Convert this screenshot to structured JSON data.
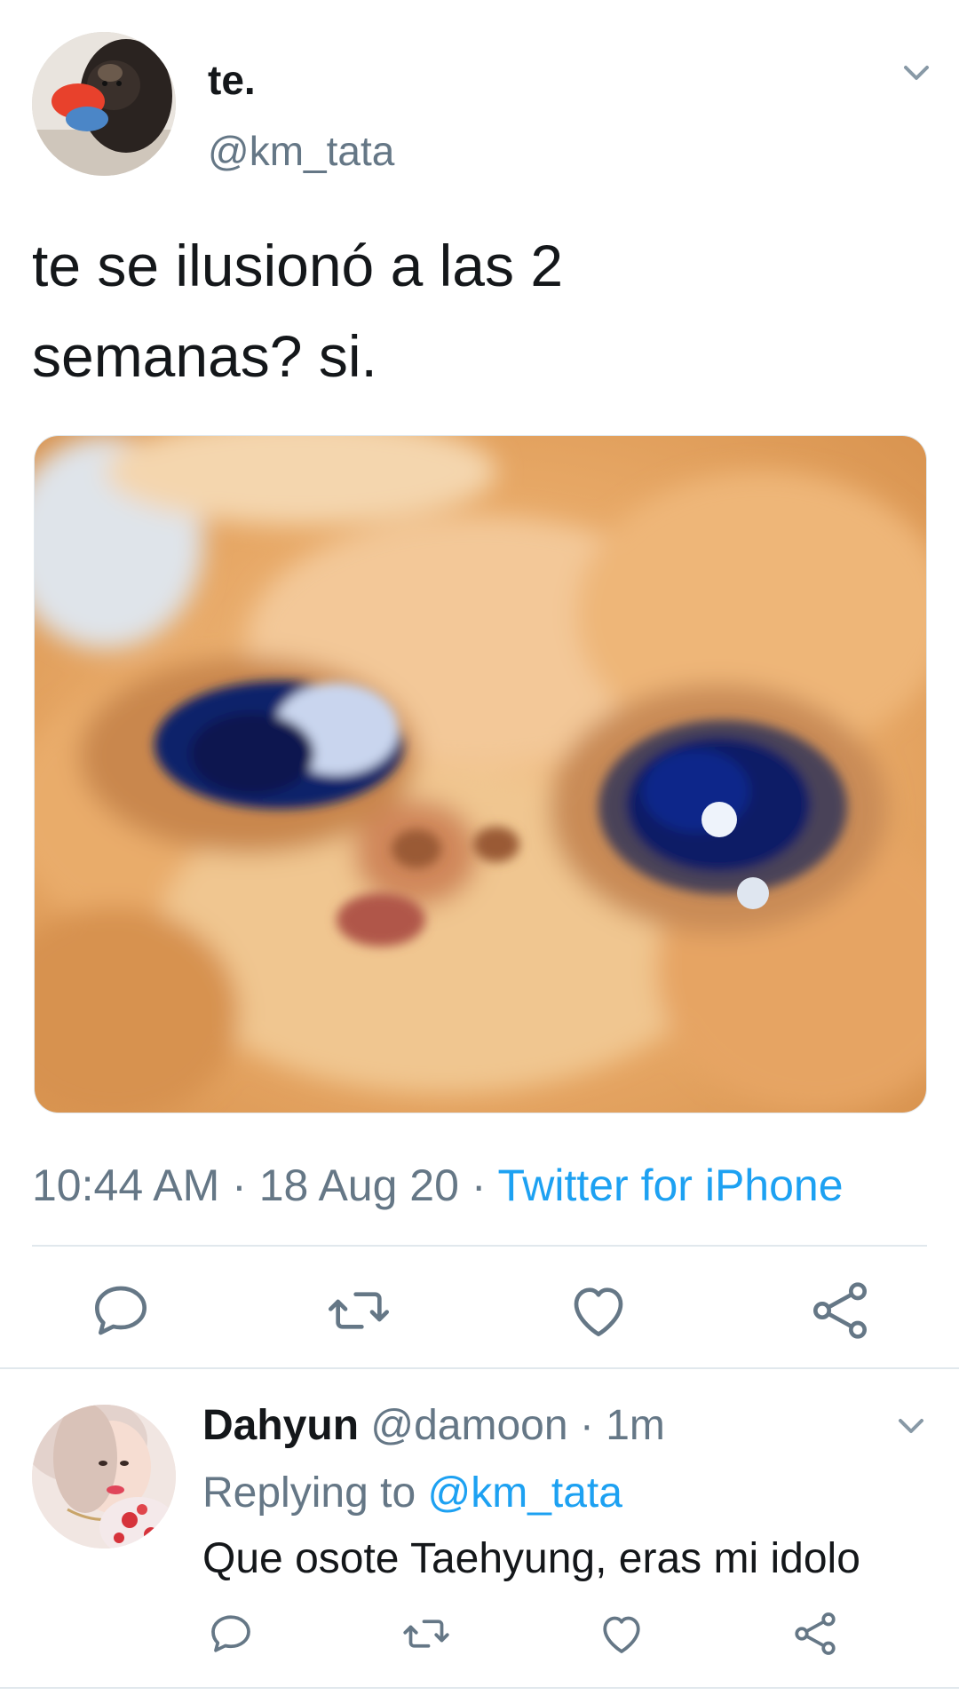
{
  "tweet": {
    "author": {
      "display_name": "te.",
      "handle": "@km_tata",
      "avatar_icon": "dog-photo-avatar"
    },
    "text": "te se ilusionó a las 2\nsemanas? si.",
    "media": {
      "icon": "crying-cat-photo"
    },
    "meta": {
      "time": "10:44 AM",
      "separator": " · ",
      "date": "18 Aug 20",
      "source": "Twitter for iPhone"
    },
    "actions": [
      "reply-icon",
      "retweet-icon",
      "like-icon",
      "share-icon"
    ]
  },
  "reply": {
    "author": {
      "display_name": "Dahyun",
      "handle": "@damoon",
      "separator": " · ",
      "age": "1m",
      "avatar_icon": "woman-photo-avatar"
    },
    "replying_label": "Replying to ",
    "replying_to": "@km_tata",
    "text": "Que osote Taehyung, eras mi idolo"
  },
  "colors": {
    "text_primary": "#14171a",
    "text_secondary": "#657786",
    "accent": "#1da1f2",
    "divider": "#e1e8ed"
  }
}
